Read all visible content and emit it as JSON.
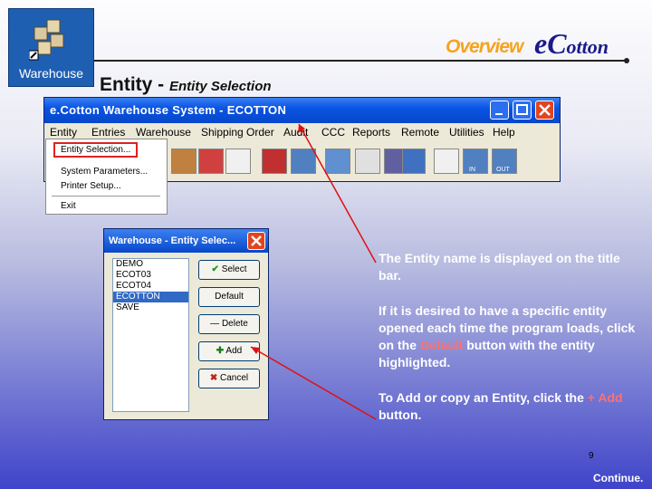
{
  "header": {
    "icon_label": "Warehouse",
    "overview": "Overview",
    "brand_e": "e",
    "brand_c": "C",
    "brand_rest": "otton",
    "title": "Entity",
    "title_sep": " - ",
    "subtitle": "Entity Selection"
  },
  "main_window": {
    "title": "e.Cotton  Warehouse  System - ECOTTON",
    "menu": [
      "Entity",
      "Entries",
      "Warehouse",
      "Shipping Order",
      "Audit",
      "CCC",
      "Reports",
      "Remote",
      "Utilities",
      "Help"
    ],
    "entity_menu": [
      "Entity Selection...",
      "System Parameters...",
      "Printer Setup...",
      "Exit"
    ],
    "toolbar_labels": [
      "IN",
      "OUT"
    ]
  },
  "entity_dialog": {
    "title": "Warehouse - Entity Selec...",
    "entities": [
      "DEMO",
      "ECOT03",
      "ECOT04",
      "ECOTTON",
      "SAVE"
    ],
    "selected_index": 3,
    "buttons": {
      "select": "Select",
      "default": "Default",
      "delete": "Delete",
      "add": "Add",
      "cancel": "Cancel"
    }
  },
  "notes": {
    "note1": "The Entity name is displayed on the title bar.",
    "note2_pre": "If it is desired to have a specific entity opened each time the program loads, click on the ",
    "note2_hl": "Default",
    "note2_post": " button with the entity highlighted.",
    "note3_pre": "To Add or copy an Entity, click the ",
    "note3_hl": "+ Add",
    "note3_post": " button."
  },
  "footer": {
    "page_number": "9",
    "continue": "Continue."
  },
  "colors": {
    "accent_orange": "#f6a321",
    "titlebar_blue": "#0a54e4",
    "highlight_red": "#e02020"
  }
}
